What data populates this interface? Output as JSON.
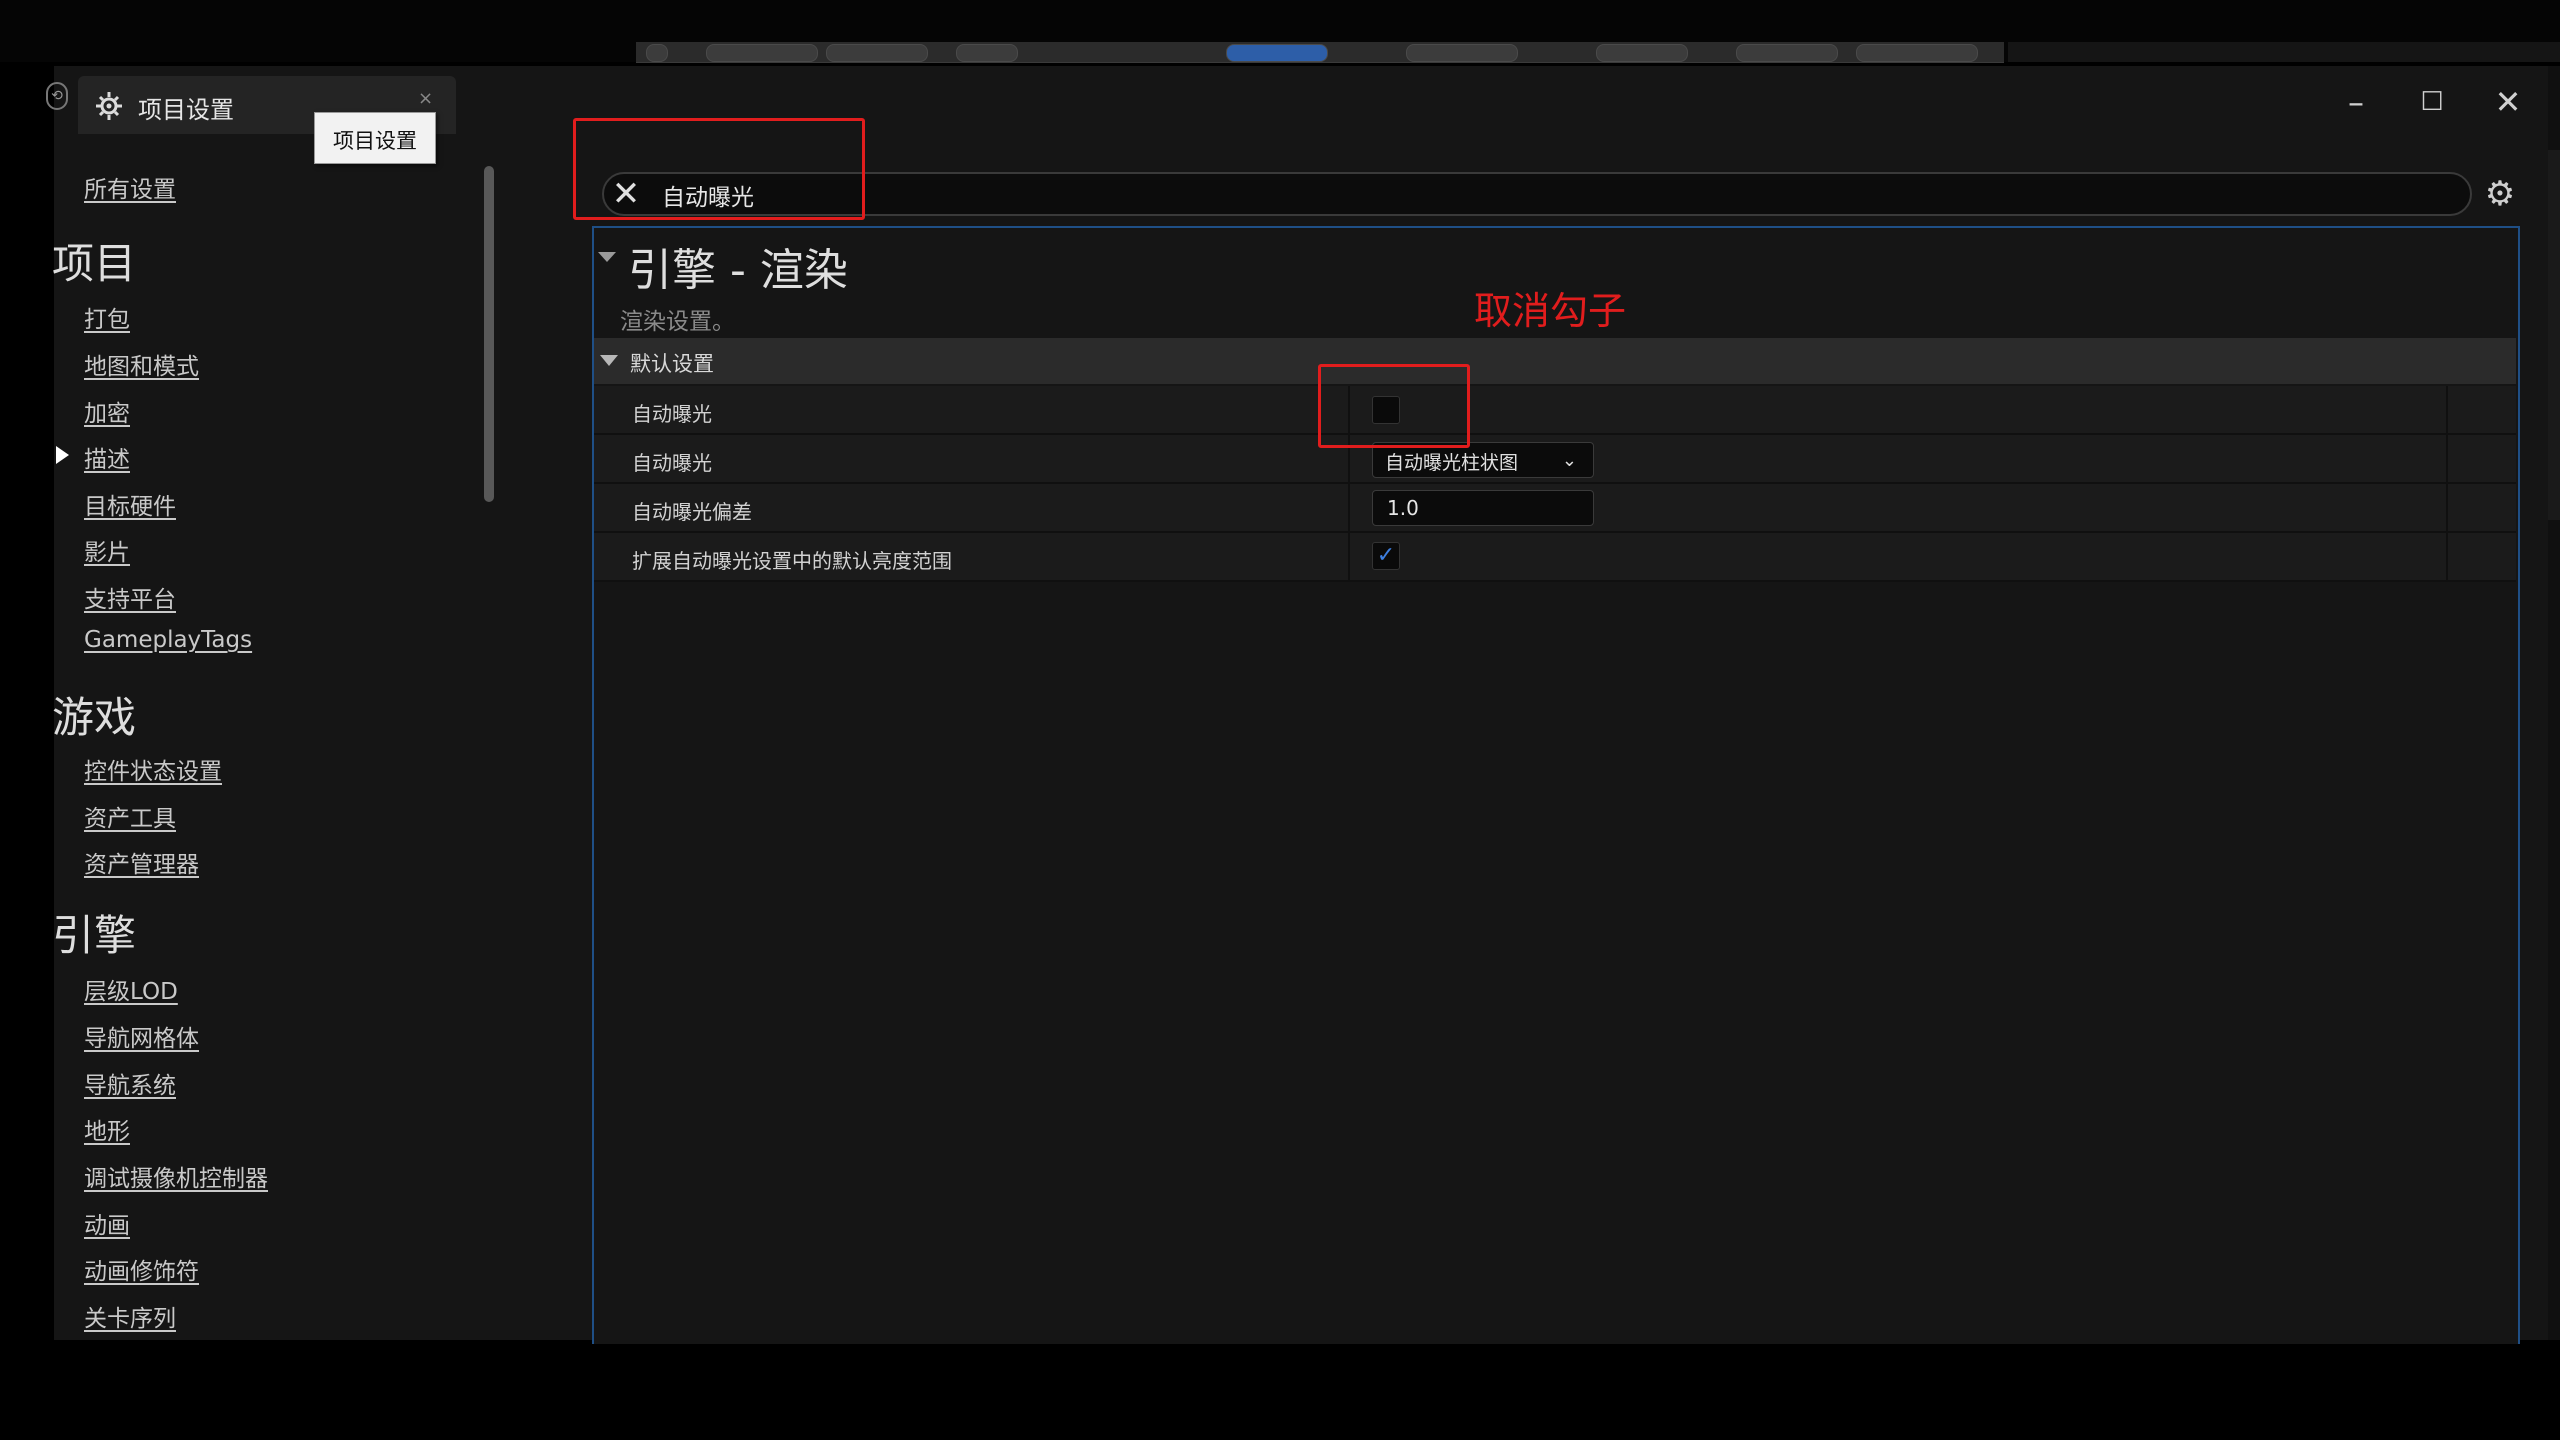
{
  "window": {
    "tab_label": "项目设置",
    "tooltip": "项目设置"
  },
  "sidebar": {
    "all_settings": "所有设置",
    "groups": [
      {
        "heading": "项目",
        "items": [
          "打包",
          "地图和模式",
          "加密",
          "描述",
          "目标硬件",
          "影片",
          "支持平台",
          "GameplayTags"
        ]
      },
      {
        "heading": "游戏",
        "items": [
          "控件状态设置",
          "资产工具",
          "资产管理器"
        ]
      },
      {
        "heading": "引擎",
        "items": [
          "层级LOD",
          "导航网格体",
          "导航系统",
          "地形",
          "调试摄像机控制器",
          "动画",
          "动画修饰符",
          "关卡序列"
        ]
      }
    ]
  },
  "search": {
    "query": "自动曝光"
  },
  "section": {
    "title": "引擎 - 渲染",
    "description": "渲染设置。",
    "category": "默认设置",
    "rows": [
      {
        "label": "自动曝光",
        "type": "checkbox",
        "checked": false
      },
      {
        "label": "自动曝光",
        "type": "combo",
        "value": "自动曝光柱状图"
      },
      {
        "label": "自动曝光偏差",
        "type": "number",
        "value": "1.0"
      },
      {
        "label": "扩展自动曝光设置中的默认亮度范围",
        "type": "checkbox",
        "checked": true
      }
    ]
  },
  "annotation": {
    "text": "取消勾子",
    "color": "#e11d1d"
  },
  "icons": {
    "tab": "project-settings-icon",
    "clear": "close-icon",
    "gear": "gear-icon",
    "check": "checkmark-icon"
  },
  "colors": {
    "accent_border": "#1f4f86",
    "checkmark": "#3d7fe0"
  }
}
